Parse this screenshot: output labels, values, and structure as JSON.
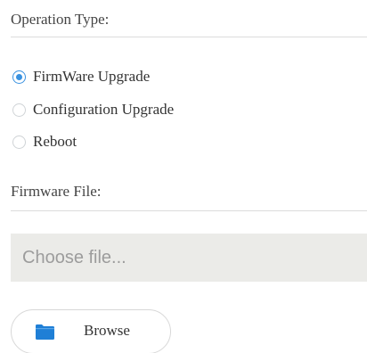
{
  "operation": {
    "title": "Operation Type:",
    "options": [
      {
        "label": "FirmWare Upgrade",
        "selected": true
      },
      {
        "label": "Configuration Upgrade",
        "selected": false
      },
      {
        "label": "Reboot",
        "selected": false
      }
    ]
  },
  "firmware": {
    "title": "Firmware File:",
    "placeholder": "Choose file...",
    "browse_label": "Browse"
  },
  "colors": {
    "accent": "#3a92e0",
    "folder_icon": "#1f7fd6",
    "input_background": "#ebebe8",
    "divider": "#dcdcdc"
  },
  "icons": {
    "browse": "folder-icon"
  }
}
